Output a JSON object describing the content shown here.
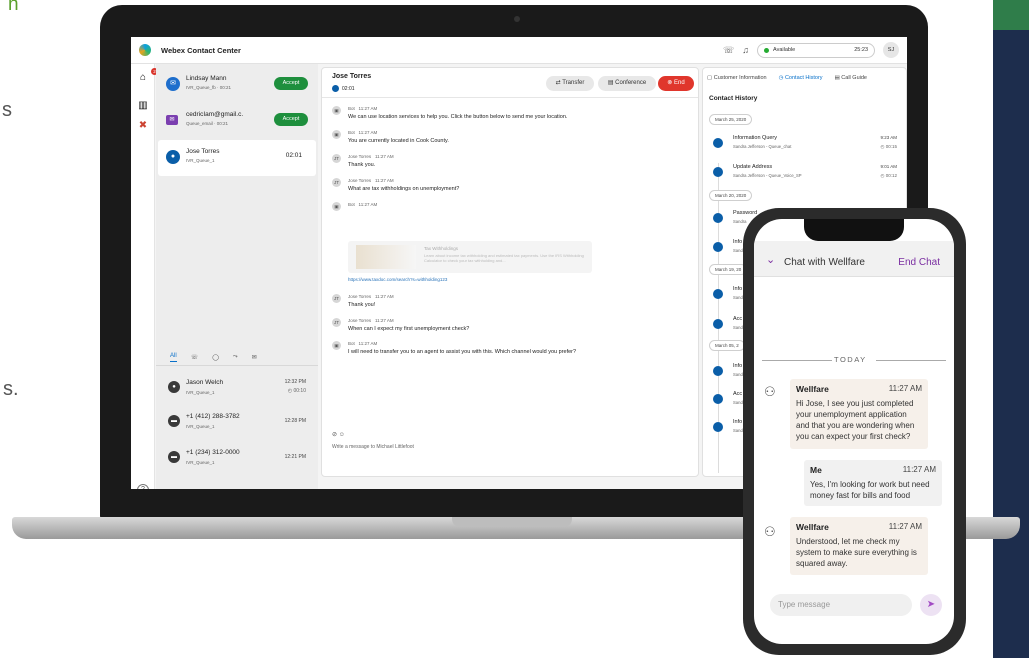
{
  "background_fragments": {
    "top": "n",
    "mid1": "s",
    "mid2": "s."
  },
  "laptop": {
    "app_title": "Webex Contact Center",
    "status": "Available",
    "status_timer": "25:23",
    "user_initials": "SJ",
    "nav_badge": "2",
    "tasks": [
      {
        "name": "Lindsay Mann",
        "sub": "IVR_Queue_fb · 00:21",
        "action": "Accept",
        "icon_color": "#1e6ecc",
        "icon": "messenger-icon"
      },
      {
        "name": "cedricIam@gmail.c.",
        "sub": "Queue_email · 00:21",
        "action": "Accept",
        "icon_color": "#7b3fb0",
        "icon": "email-icon"
      },
      {
        "name": "Jose Torres",
        "sub": "IVR_Queue_1",
        "timer": "02:01",
        "icon_color": "#0a5ea8",
        "icon": "chat-icon"
      }
    ],
    "tabs": [
      "All",
      "☏",
      "◯",
      "⤳",
      "✉"
    ],
    "history": [
      {
        "name": "Jason Welch",
        "sub": "IVR_Queue_1",
        "time": "12:32 PM",
        "duration": "◴ 00:10"
      },
      {
        "name": "+1 (412) 288-3782",
        "sub": "IVR_Queue_1",
        "time": "12:28 PM",
        "duration": ""
      },
      {
        "name": "+1 (234) 312-0000",
        "sub": "IVR_Queue_1",
        "time": "12:21 PM",
        "duration": ""
      }
    ],
    "chat": {
      "contact": "Jose Torres",
      "timer": "02:01",
      "transfer": "Transfer",
      "conference": "Conference",
      "end": "End",
      "messages": [
        {
          "who": "Bot",
          "time": "11:27 AM",
          "text": "We can use location services to help you.  Click the button below to send me your location."
        },
        {
          "who": "Bot",
          "time": "11:27 AM",
          "text": "You are currently located in Cook County."
        },
        {
          "who": "Jose Torres",
          "time": "11:27 AM",
          "text": "Thank you."
        },
        {
          "who": "Jose Torres",
          "time": "11:27 AM",
          "text": "What are tax withholdings on unemployment?"
        },
        {
          "who": "Bot",
          "time": "11:27 AM",
          "text": ""
        },
        {
          "who": "Jose Torres",
          "time": "11:27 AM",
          "text": "Thank you!"
        },
        {
          "who": "Jose Torres",
          "time": "11:27 AM",
          "text": "When can I expect my first unemployment check?"
        },
        {
          "who": "Bot",
          "time": "11:27 AM",
          "text": "I will need to transfer you to an agent to assist you with this.  Which channel would you prefer?"
        }
      ],
      "card_title": "Tax Withholdings",
      "card_desc": "Learn about income tax withholding and estimated tax payments. Use the IRS Withholding Calculator to check your tax withholding and...",
      "link": "https://www.taxdoc.com/search?s=withholding123",
      "compose_placeholder": "Write a message to Michael Littlefoot"
    },
    "right_panel": {
      "tabs": [
        "Customer Information",
        "Contact History",
        "Call Guide"
      ],
      "title": "Contact History",
      "groups": [
        {
          "date": "March 25, 2020",
          "items": [
            {
              "name": "Information Query",
              "sub": "Sandra Jefferson - Queue_chat",
              "time": "9:23 AM",
              "duration": "◴ 00:15"
            },
            {
              "name": "Update Address",
              "sub": "Sandra Jefferson - Queue_Voice_SP",
              "time": "9:01 AM",
              "duration": "◴ 00:12"
            }
          ]
        },
        {
          "date": "March 20, 2020",
          "items": [
            {
              "name": "Password",
              "sub": "Sandra"
            },
            {
              "name": "Info",
              "sub": "Sand"
            }
          ]
        },
        {
          "date": "March 19, 20",
          "items": [
            {
              "name": "Info",
              "sub": "Sand"
            },
            {
              "name": "Acc",
              "sub": "Sand"
            }
          ]
        },
        {
          "date": "March 05, 2",
          "items": [
            {
              "name": "Info",
              "sub": "Sand"
            },
            {
              "name": "Acc",
              "sub": "Sand"
            },
            {
              "name": "Info",
              "sub": "Sand"
            }
          ]
        }
      ]
    }
  },
  "phone": {
    "title": "Chat with Wellfare",
    "end_chat": "End Chat",
    "today": "TODAY",
    "messages": [
      {
        "from": "Wellfare",
        "time": "11:27 AM",
        "text": "Hi Jose, I see you just completed your unemployment application and that you are wondering when you can expect your first check?"
      },
      {
        "from": "Me",
        "time": "11:27 AM",
        "text": "Yes, I'm looking for work but need money fast for bills and food"
      },
      {
        "from": "Wellfare",
        "time": "11:27 AM",
        "text": "Understood, let me check my system to make sure everything is squared away."
      }
    ],
    "placeholder": "Type message",
    "accent": "#7a2ea1"
  }
}
